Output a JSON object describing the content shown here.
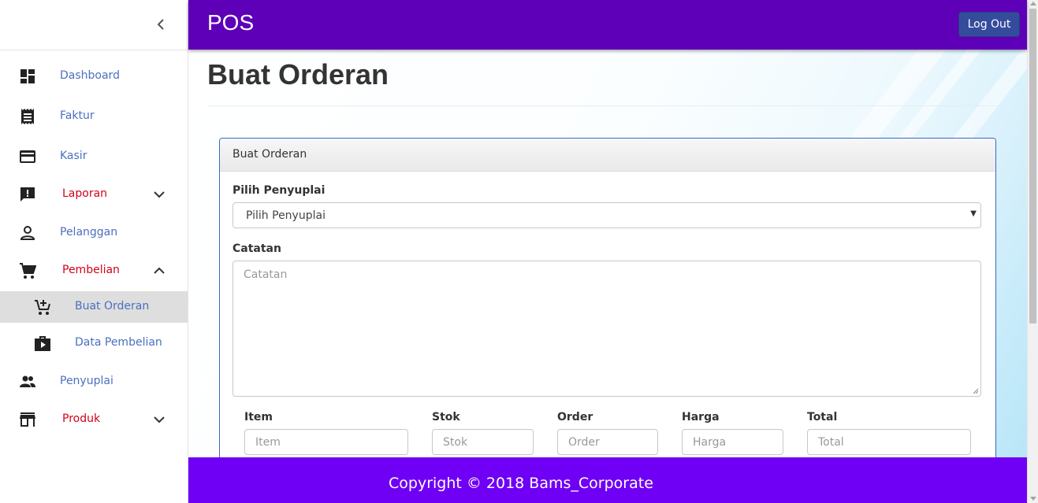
{
  "colors": {
    "header_bg": "#5e00b8",
    "footer_bg": "#6f00f5",
    "logout_bg": "#354c9c",
    "link_blue": "#4a6fc0",
    "accent_red": "#d0021b",
    "panel_border": "#3a68c4"
  },
  "header": {
    "brand": "POS",
    "logout_label": "Log Out"
  },
  "sidebar": {
    "collapse_icon": "chevron-left-icon",
    "items": [
      {
        "label": "Dashboard",
        "icon": "dashboard-icon"
      },
      {
        "label": "Faktur",
        "icon": "receipt-icon"
      },
      {
        "label": "Kasir",
        "icon": "credit-card-icon"
      },
      {
        "label": "Laporan",
        "icon": "report-icon",
        "expandable": true,
        "expanded": false
      },
      {
        "label": "Pelanggan",
        "icon": "person-icon"
      },
      {
        "label": "Pembelian",
        "icon": "shopping-cart-icon",
        "expandable": true,
        "expanded": true
      },
      {
        "label": "Buat Orderan",
        "icon": "add-cart-icon",
        "sub": true,
        "active": true
      },
      {
        "label": "Data Pembelian",
        "icon": "shop-bag-icon",
        "sub": true
      },
      {
        "label": "Penyuplai",
        "icon": "people-icon"
      },
      {
        "label": "Produk",
        "icon": "store-icon",
        "expandable": true,
        "expanded": false
      }
    ]
  },
  "page": {
    "title": "Buat Orderan"
  },
  "form": {
    "panel_title": "Buat Orderan",
    "supplier_label": "Pilih Penyuplai",
    "supplier_selected": "Pilih Penyuplai",
    "notes_label": "Catatan",
    "notes_placeholder": "Catatan",
    "columns": [
      {
        "label": "Item",
        "placeholder": "Item"
      },
      {
        "label": "Stok",
        "placeholder": "Stok"
      },
      {
        "label": "Order",
        "placeholder": "Order"
      },
      {
        "label": "Harga",
        "placeholder": "Harga"
      },
      {
        "label": "Total",
        "placeholder": "Total"
      }
    ]
  },
  "footer": {
    "copyright": "Copyright © 2018 Bams_Corporate"
  }
}
